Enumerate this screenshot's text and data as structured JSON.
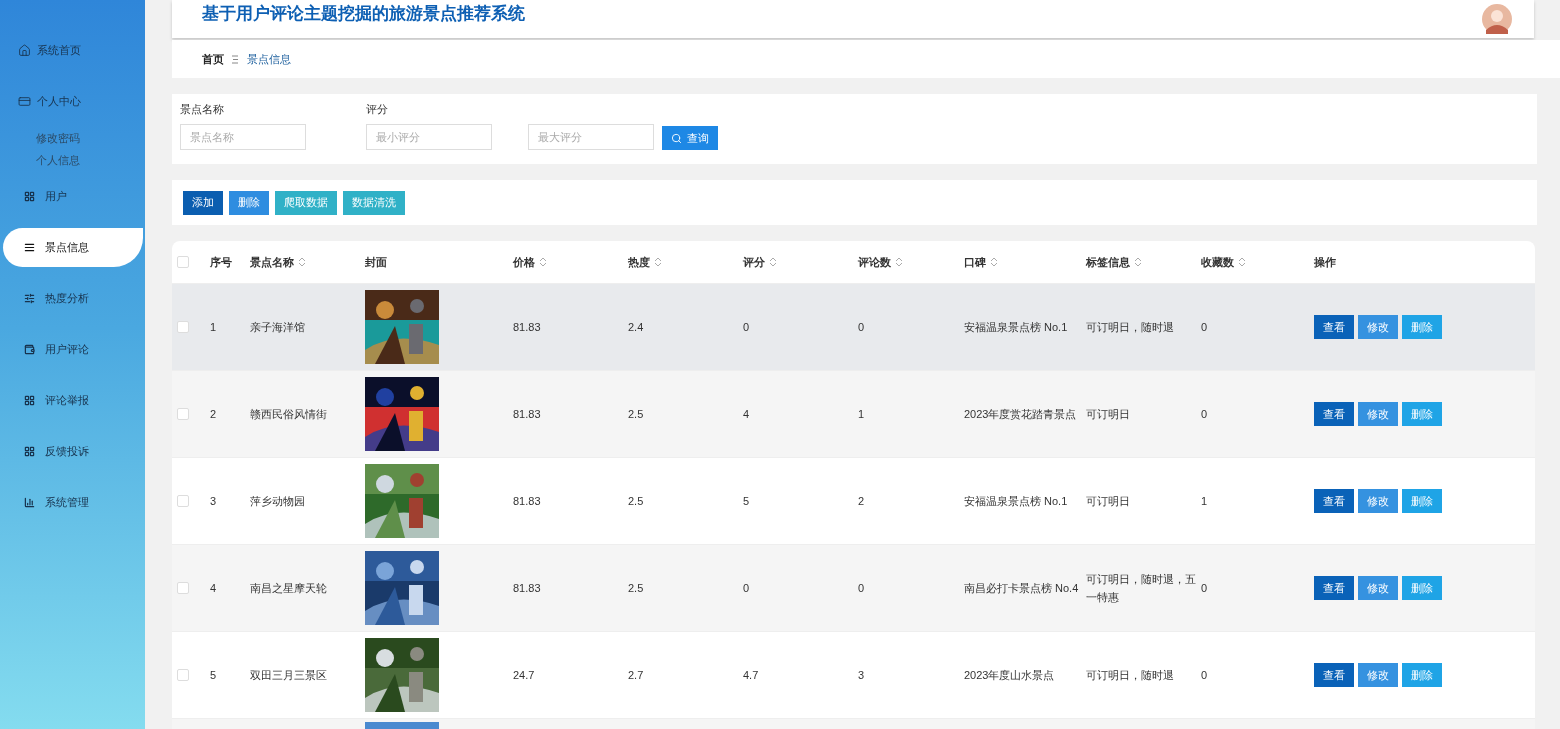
{
  "sidebar": {
    "items": [
      {
        "label": "系统首页",
        "kind": "top",
        "selected": false
      },
      {
        "label": "个人中心",
        "kind": "top",
        "selected": false
      },
      {
        "label": "修改密码",
        "kind": "sub",
        "selected": false
      },
      {
        "label": "个人信息",
        "kind": "sub",
        "selected": false
      },
      {
        "label": "用户",
        "kind": "item",
        "selected": false
      },
      {
        "label": "景点信息",
        "kind": "item",
        "selected": true
      },
      {
        "label": "热度分析",
        "kind": "item",
        "selected": false
      },
      {
        "label": "用户评论",
        "kind": "item",
        "selected": false
      },
      {
        "label": "评论举报",
        "kind": "item",
        "selected": false
      },
      {
        "label": "反馈投诉",
        "kind": "item",
        "selected": false
      },
      {
        "label": "系统管理",
        "kind": "item",
        "selected": false
      }
    ]
  },
  "header": {
    "title": "基于用户评论主题挖掘的旅游景点推荐系统"
  },
  "breadcrumb": [
    "首页",
    "景点信息"
  ],
  "search": {
    "labels": [
      "景点名称",
      "评分"
    ],
    "fields": [
      {
        "placeholder": "景点名称"
      },
      {
        "placeholder": "最小评分"
      },
      {
        "placeholder": "最大评分"
      }
    ],
    "button": "查询"
  },
  "toolbar": [
    {
      "label": "添加",
      "kind": "primary"
    },
    {
      "label": "删除",
      "kind": "secondary"
    },
    {
      "label": "爬取数据",
      "kind": "info"
    },
    {
      "label": "数据清洗",
      "kind": "info"
    }
  ],
  "table": {
    "header_checked": false,
    "columns": [
      {
        "label": "序号",
        "sortable": false
      },
      {
        "label": "景点名称",
        "sortable": true
      },
      {
        "label": "封面",
        "sortable": false
      },
      {
        "label": "价格",
        "sortable": true
      },
      {
        "label": "热度",
        "sortable": true
      },
      {
        "label": "评分",
        "sortable": true
      },
      {
        "label": "评论数",
        "sortable": true
      },
      {
        "label": "口碑",
        "sortable": true
      },
      {
        "label": "标签信息",
        "sortable": true
      },
      {
        "label": "收藏数",
        "sortable": true
      },
      {
        "label": "操作",
        "sortable": false
      }
    ],
    "rows": [
      {
        "checked": false,
        "hovered": true,
        "cells": [
          "1",
          "亲子海洋馆",
          "81.83",
          "2.4",
          "0",
          "0",
          "安福温泉景点榜 No.1",
          "可订明日，随时退",
          "0"
        ],
        "actions": [
          "查看",
          "修改",
          "删除"
        ]
      },
      {
        "checked": false,
        "hovered": false,
        "cells": [
          "2",
          "赣西民俗风情街",
          "81.83",
          "2.5",
          "4",
          "1",
          "2023年度赏花踏青景点",
          "可订明日",
          "0"
        ],
        "actions": [
          "查看",
          "修改",
          "删除"
        ]
      },
      {
        "checked": false,
        "hovered": false,
        "cells": [
          "3",
          "萍乡动物园",
          "81.83",
          "2.5",
          "5",
          "2",
          "安福温泉景点榜 No.1",
          "可订明日",
          "1"
        ],
        "actions": [
          "查看",
          "修改",
          "删除"
        ]
      },
      {
        "checked": false,
        "hovered": false,
        "cells": [
          "4",
          "南昌之星摩天轮",
          "81.83",
          "2.5",
          "0",
          "0",
          "南昌必打卡景点榜 No.4",
          "可订明日，随时退，五一特惠",
          "0"
        ],
        "actions": [
          "查看",
          "修改",
          "删除"
        ]
      },
      {
        "checked": false,
        "hovered": false,
        "cells": [
          "5",
          "双田三月三景区",
          "24.7",
          "2.7",
          "4.7",
          "3",
          "2023年度山水景点",
          "可订明日，随时退",
          "0"
        ],
        "actions": [
          "查看",
          "修改",
          "删除"
        ]
      },
      {
        "kind": "partial",
        "hovered": false
      }
    ]
  }
}
